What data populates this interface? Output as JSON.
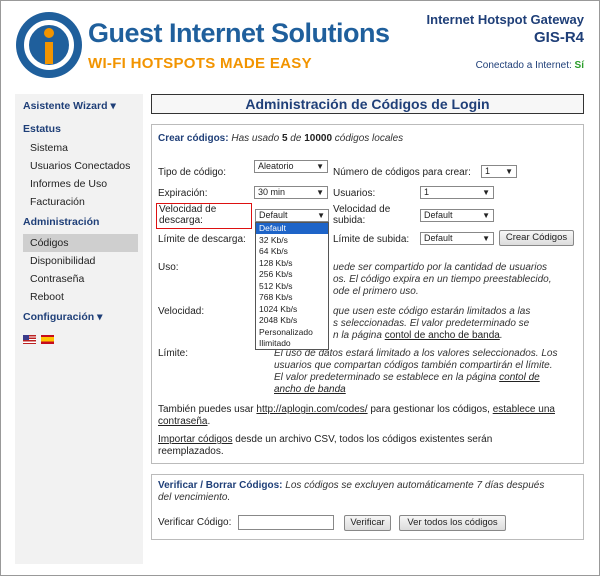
{
  "brand": {
    "name": "Guest Internet Solutions",
    "tagline": "WI-FI HOTSPOTS MADE EASY"
  },
  "header": {
    "product": "Internet Hotspot Gateway",
    "model": "GIS-R4",
    "connection_label": "Conectado a Internet:",
    "connection_value": "Sí"
  },
  "sidebar": {
    "wizard": "Asistente Wizard",
    "status_heading": "Estatus",
    "status_items": [
      "Sistema",
      "Usuarios Conectados",
      "Informes de Uso",
      "Facturación"
    ],
    "admin_heading": "Administración",
    "admin_items": [
      "Códigos",
      "Disponibilidad",
      "Contraseña",
      "Reboot"
    ],
    "config_heading": "Configuración"
  },
  "page_title": "Administración de Códigos de Login",
  "create": {
    "heading": "Crear códigos:",
    "usage_pre": "Has usado",
    "usage_used": "5",
    "usage_mid": "de",
    "usage_total": "10000",
    "usage_post": "códigos locales",
    "code_type_label": "Tipo de código:",
    "code_type_value": "Aleatorio",
    "count_label": "Número de códigos para crear:",
    "count_value": "1",
    "expiry_label": "Expiración:",
    "expiry_value": "30 min",
    "users_label": "Usuarios:",
    "users_value": "1",
    "download_label_1": "Velocidad de",
    "download_label_2": "descarga:",
    "download_value": "Default",
    "upload_label_1": "Velocidad de",
    "upload_label_2": "subida:",
    "upload_value": "Default",
    "dl_limit_label": "Límite de descarga:",
    "ul_limit_label": "Límite de subida:",
    "ul_limit_value": "Default",
    "create_button": "Crear Códigos",
    "speed_options": [
      "Default",
      "32 Kb/s",
      "64 Kb/s",
      "128 Kb/s",
      "256 Kb/s",
      "512 Kb/s",
      "768 Kb/s",
      "1024 Kb/s",
      "2048 Kb/s",
      "Personalizado",
      "Ilimitado"
    ]
  },
  "help": {
    "uso_label": "Uso:",
    "uso_l1": "uede ser compartido por la cantidad de usuarios",
    "uso_l2": "os. El código expira en un tiempo preestablecido,",
    "uso_l3": "ode el primero uso.",
    "vel_label": "Velocidad:",
    "vel_l1": "que usen este código estarán limitados a las",
    "vel_l2": "s seleccionadas. El valor predeterminado se",
    "vel_l3_pre": "n la página",
    "vel_l3_link": "contol de ancho de banda",
    "vel_l3_post": ".",
    "lim_label": "Límite:",
    "lim_l1": "El uso de datos estará limitado a los valores seleccionados. Los",
    "lim_l2": "usuarios que compartan códigos también compartirán el límite.",
    "lim_l3_pre": "El valor predeterminado se establece en la página",
    "lim_l3_link": "contol de",
    "lim_l4_link": "ancho de banda",
    "aplogin_pre": "También puedes usar",
    "aplogin_link": "http://aplogin.com/codes/",
    "aplogin_mid": "para gestionar los códigos,",
    "aplogin_link2": "establece una",
    "aplogin_link3": "contraseña",
    "aplogin_end": ".",
    "import_link": "Importar códigos",
    "import_l1": "desde un archivo CSV, todos los códigos existentes serán",
    "import_l2": "reemplazados."
  },
  "verify": {
    "heading": "Verificar / Borrar Códigos:",
    "note_l1": "Los códigos se excluyen automáticamente 7 días después",
    "note_l2": "del vencimiento.",
    "field_label": "Verificar Código:",
    "verify_button": "Verificar",
    "view_all_button": "Ver todos los códigos"
  }
}
